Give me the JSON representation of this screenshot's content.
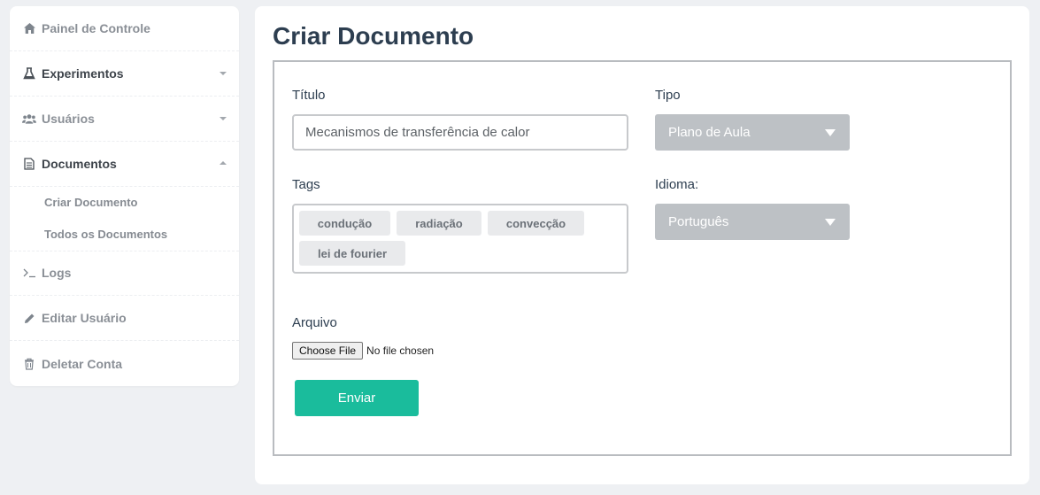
{
  "sidebar": {
    "items": [
      {
        "label": "Painel de Controle",
        "icon": "home-icon"
      },
      {
        "label": "Experimentos",
        "icon": "flask-icon"
      },
      {
        "label": "Usuários",
        "icon": "users-icon"
      },
      {
        "label": "Documentos",
        "icon": "document-icon"
      },
      {
        "label": "Logs",
        "icon": "terminal-icon"
      },
      {
        "label": "Editar Usuário",
        "icon": "pencil-icon"
      },
      {
        "label": "Deletar Conta",
        "icon": "trash-icon"
      }
    ],
    "subitems": [
      {
        "label": "Criar Documento"
      },
      {
        "label": "Todos os Documentos"
      }
    ]
  },
  "main": {
    "title": "Criar Documento",
    "form": {
      "title_label": "Título",
      "title_value": "Mecanismos de transferência de calor",
      "type_label": "Tipo",
      "type_value": "Plano de Aula",
      "tags_label": "Tags",
      "tags": [
        "condução",
        "radiação",
        "convecção",
        "lei de fourier"
      ],
      "language_label": "Idioma:",
      "language_value": "Português",
      "file_label": "Arquivo",
      "file_button": "Choose File",
      "file_status": "No file chosen",
      "submit_label": "Enviar"
    }
  },
  "colors": {
    "accent": "#1abc9c",
    "title": "#2d3e50",
    "select_bg": "#bdc1c5"
  }
}
